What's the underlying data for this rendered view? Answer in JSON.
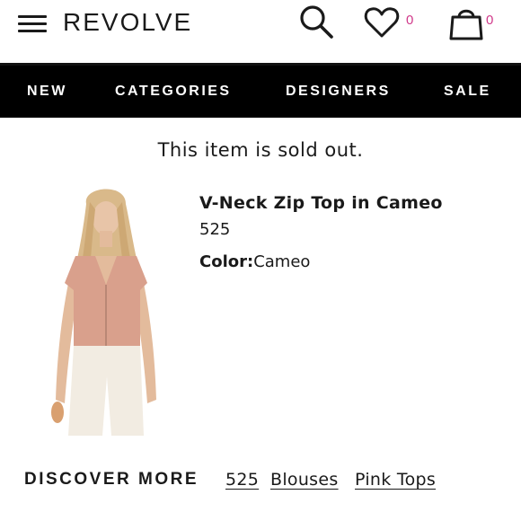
{
  "header": {
    "logo": "REVOLVE",
    "wishlist_count": "0",
    "bag_count": "0",
    "icons": [
      "menu-icon",
      "search-icon",
      "heart-icon",
      "shopping-bag-icon"
    ]
  },
  "nav": {
    "items": [
      {
        "label": "NEW"
      },
      {
        "label": "CATEGORIES"
      },
      {
        "label": "DESIGNERS"
      },
      {
        "label": "SALE"
      }
    ]
  },
  "status": {
    "message": "This item is sold out."
  },
  "product": {
    "name": "V-Neck Zip Top in Cameo",
    "code": "525",
    "color_label": "Color:",
    "color_value": "Cameo"
  },
  "discover": {
    "heading": "DISCOVER MORE",
    "links": [
      "525",
      "Blouses",
      "Pink Tops"
    ]
  },
  "colors": {
    "accent_pink": "#d0398a",
    "nav_background": "#000000",
    "top_color": "#d9a08c"
  }
}
